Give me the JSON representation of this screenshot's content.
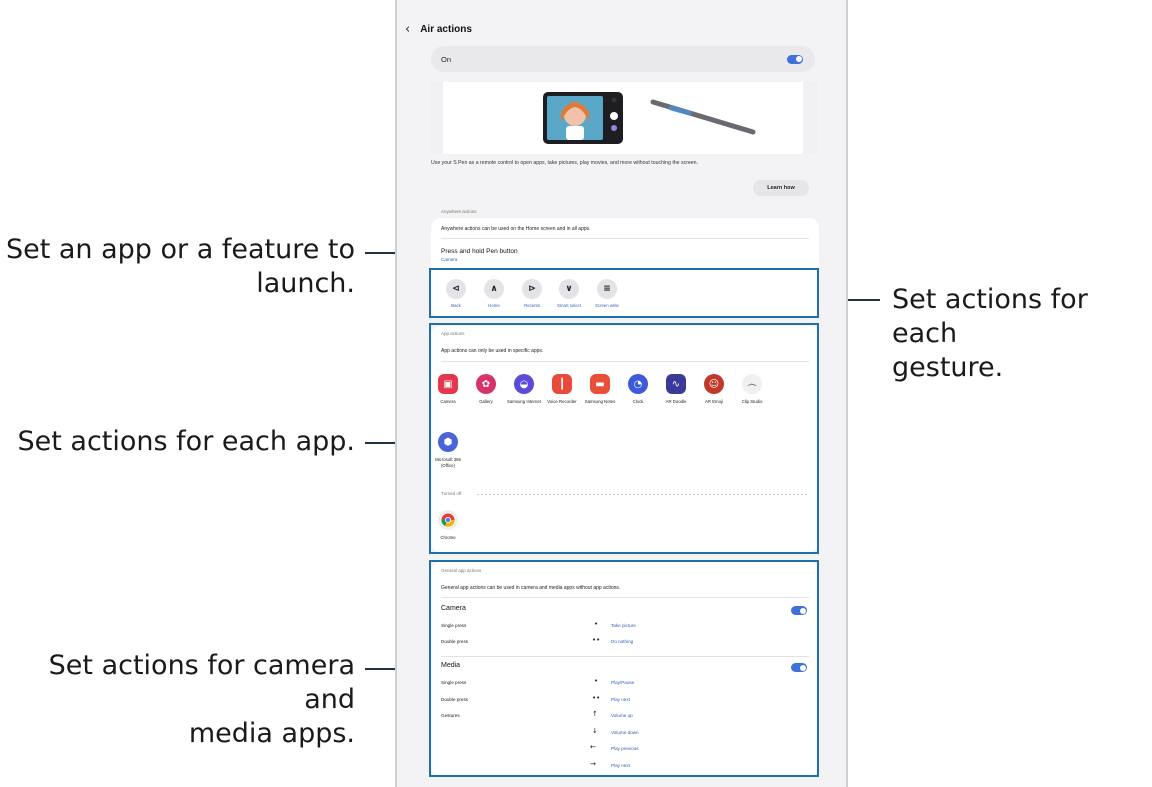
{
  "callouts": {
    "launch_line1": "Set an app or a feature to",
    "launch_line2": "launch.",
    "gesture_line1": "Set actions for each",
    "gesture_line2": "gesture.",
    "app": "Set actions for each app.",
    "media_line1": "Set actions for camera and",
    "media_line2": "media apps."
  },
  "screen": {
    "back_icon": "chevron-left-icon",
    "title": "Air actions",
    "on_label": "On",
    "on_toggle": true,
    "description": "Use your S Pen as a remote control to open apps, take pictures, play movies, and more without touching the screen.",
    "learn_how": "Learn how"
  },
  "anywhere": {
    "section": "Anywhere actions",
    "info": "Anywhere actions can be used on the Home screen and in all apps.",
    "press_title": "Press and hold Pen button",
    "press_value": "Camera",
    "gestures": [
      {
        "label": "Back",
        "icon": "back-gesture-icon"
      },
      {
        "label": "Home",
        "icon": "home-gesture-icon"
      },
      {
        "label": "Recents",
        "icon": "recents-gesture-icon"
      },
      {
        "label": "Smart select",
        "icon": "smart-select-gesture-icon"
      },
      {
        "label": "Screen write",
        "icon": "screen-write-gesture-icon"
      }
    ]
  },
  "app_actions": {
    "section": "App actions",
    "info": "App actions can only be used in specific apps.",
    "apps": [
      {
        "label": "Camera",
        "color": "#e2384d"
      },
      {
        "label": "Gallery",
        "color": "#d6336c"
      },
      {
        "label": "Samsung Internet",
        "color": "#5b4bd8"
      },
      {
        "label": "Voice Recorder",
        "color": "#e84a3c"
      },
      {
        "label": "Samsung Notes",
        "color": "#e8503a"
      },
      {
        "label": "Clock",
        "color": "#3d5bd9"
      },
      {
        "label": "AR Doodle",
        "color": "#3a3a9a"
      },
      {
        "label": "AR Emoji",
        "color": "#c0392b"
      },
      {
        "label": "Clip Studio",
        "color": "#f0f0f0"
      }
    ],
    "app_row2": [
      {
        "label": "Microsoft 365 (Office)",
        "color": "#4a63d8"
      }
    ],
    "turned_off": "Turned off",
    "off_apps": [
      {
        "label": "Chrome",
        "color": "#eeeeee"
      }
    ]
  },
  "general": {
    "section": "General app actions",
    "info": "General app actions can be used in camera and media apps without app actions.",
    "camera": {
      "title": "Camera",
      "toggle": true,
      "rows": [
        {
          "label": "Single press",
          "sym": "•",
          "value": "Take picture"
        },
        {
          "label": "Double press",
          "sym": "••",
          "value": "Do nothing"
        }
      ]
    },
    "media": {
      "title": "Media",
      "toggle": true,
      "rows": [
        {
          "label": "Single press",
          "sym": "•",
          "value": "Play/Pause"
        },
        {
          "label": "Double press",
          "sym": "••",
          "value": "Play next"
        },
        {
          "label": "Gestures",
          "sym": "↑",
          "value": "Volume up"
        },
        {
          "label": "",
          "sym": "↓",
          "value": "Volume down"
        },
        {
          "label": "",
          "sym": "←",
          "value": "Play previous"
        },
        {
          "label": "",
          "sym": "→",
          "value": "Play next"
        }
      ]
    }
  }
}
